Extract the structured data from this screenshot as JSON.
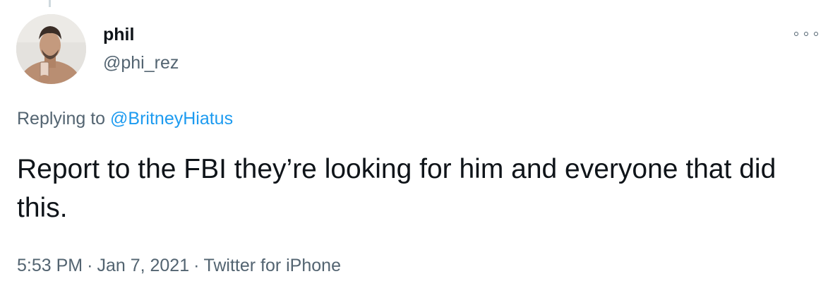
{
  "author": {
    "display_name": "phil",
    "handle": "@phi_rez",
    "avatar_icon": "user-avatar-photo"
  },
  "reply": {
    "prefix": "Replying to ",
    "mention": "@BritneyHiatus"
  },
  "tweet": {
    "text": "Report to the FBI they’re looking for him and everyone that did this."
  },
  "meta": {
    "time": "5:53 PM",
    "separator": "·",
    "date": "Jan 7, 2021",
    "source": "Twitter for iPhone"
  },
  "icons": {
    "more": "more-options-icon"
  },
  "colors": {
    "text_primary": "#0f1419",
    "text_secondary": "#536471",
    "link": "#1d9bf0",
    "background": "#ffffff"
  }
}
